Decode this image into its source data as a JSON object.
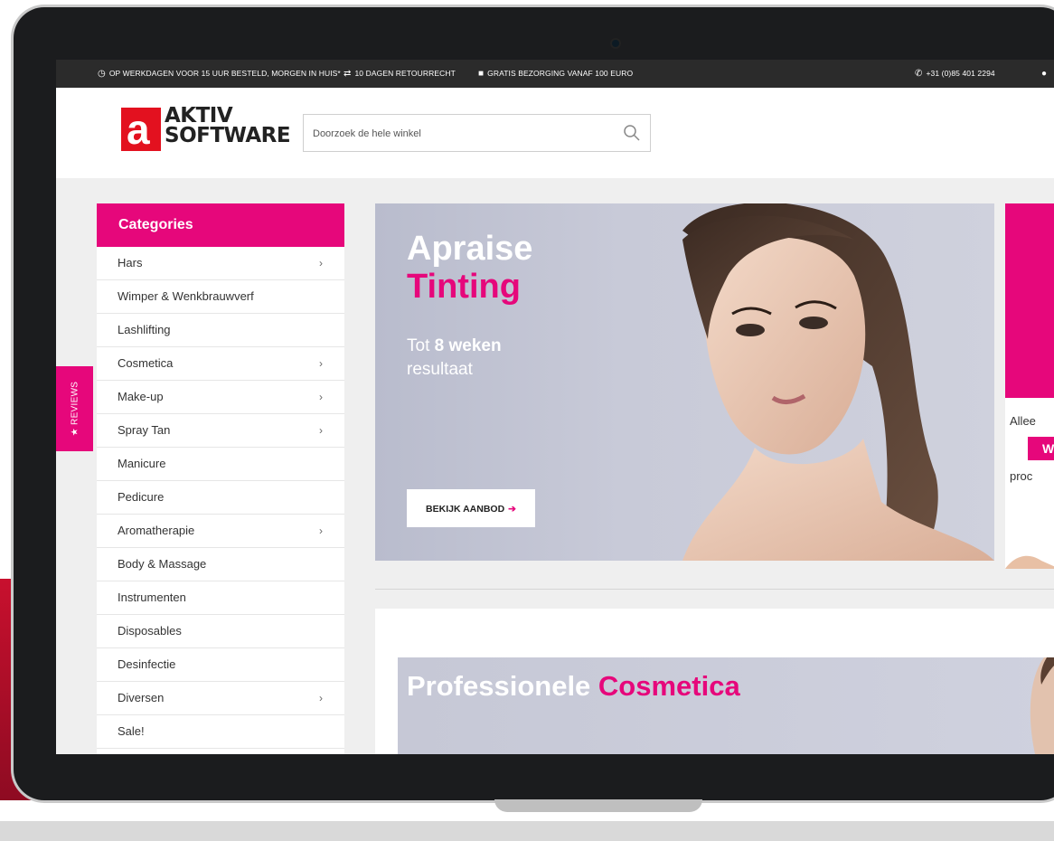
{
  "topbar": {
    "delivery": "OP WERKDAGEN VOOR 15 UUR BESTELD, MORGEN IN HUIS*",
    "returns": "10 DAGEN RETOURRECHT",
    "shipping": "GRATIS BEZORGING VANAF 100 EURO",
    "phone": "+31 (0)85 401 2294"
  },
  "logo": {
    "line1": "AKTIV",
    "line2": "SOFTWARE",
    "mark": "a"
  },
  "search": {
    "placeholder": "Doorzoek de hele winkel",
    "value": ""
  },
  "sidebar": {
    "title": "Categories",
    "items": [
      {
        "label": "Hars",
        "chevron": "›"
      },
      {
        "label": "Wimper & Wenkbrauwverf",
        "chevron": ""
      },
      {
        "label": "Lashlifting",
        "chevron": ""
      },
      {
        "label": "Cosmetica",
        "chevron": "›"
      },
      {
        "label": "Make-up",
        "chevron": "›"
      },
      {
        "label": "Spray Tan",
        "chevron": "›"
      },
      {
        "label": "Manicure",
        "chevron": ""
      },
      {
        "label": "Pedicure",
        "chevron": ""
      },
      {
        "label": "Aromatherapie",
        "chevron": "›"
      },
      {
        "label": "Body & Massage",
        "chevron": ""
      },
      {
        "label": "Instrumenten",
        "chevron": ""
      },
      {
        "label": "Disposables",
        "chevron": ""
      },
      {
        "label": "Desinfectie",
        "chevron": ""
      },
      {
        "label": "Diversen",
        "chevron": "›"
      },
      {
        "label": "Sale!",
        "chevron": ""
      }
    ]
  },
  "reviews_tab": {
    "label": "★ REVIEWS"
  },
  "hero": {
    "title_line1": "Apraise",
    "title_line2": "Tinting",
    "subtitle_prefix": "Tot ",
    "subtitle_bold": "8 weken",
    "subtitle_line2": "resultaat",
    "button_label": "BEKIJK AANBOD",
    "button_icon": "➔"
  },
  "promo": {
    "line1": "Allee",
    "badge": "W",
    "line2": "proc"
  },
  "section2": {
    "title_prefix": "Professionele ",
    "title_accent": "Cosmetica"
  },
  "colors": {
    "accent": "#e6077b",
    "topbar": "#2b2b2b",
    "logo_red": "#e3111f"
  },
  "icons": {
    "delivery": "clock-icon",
    "returns": "arrows-icon",
    "shipping": "truck-icon",
    "phone": "phone-icon",
    "account": "user-icon",
    "search": "search-icon"
  }
}
